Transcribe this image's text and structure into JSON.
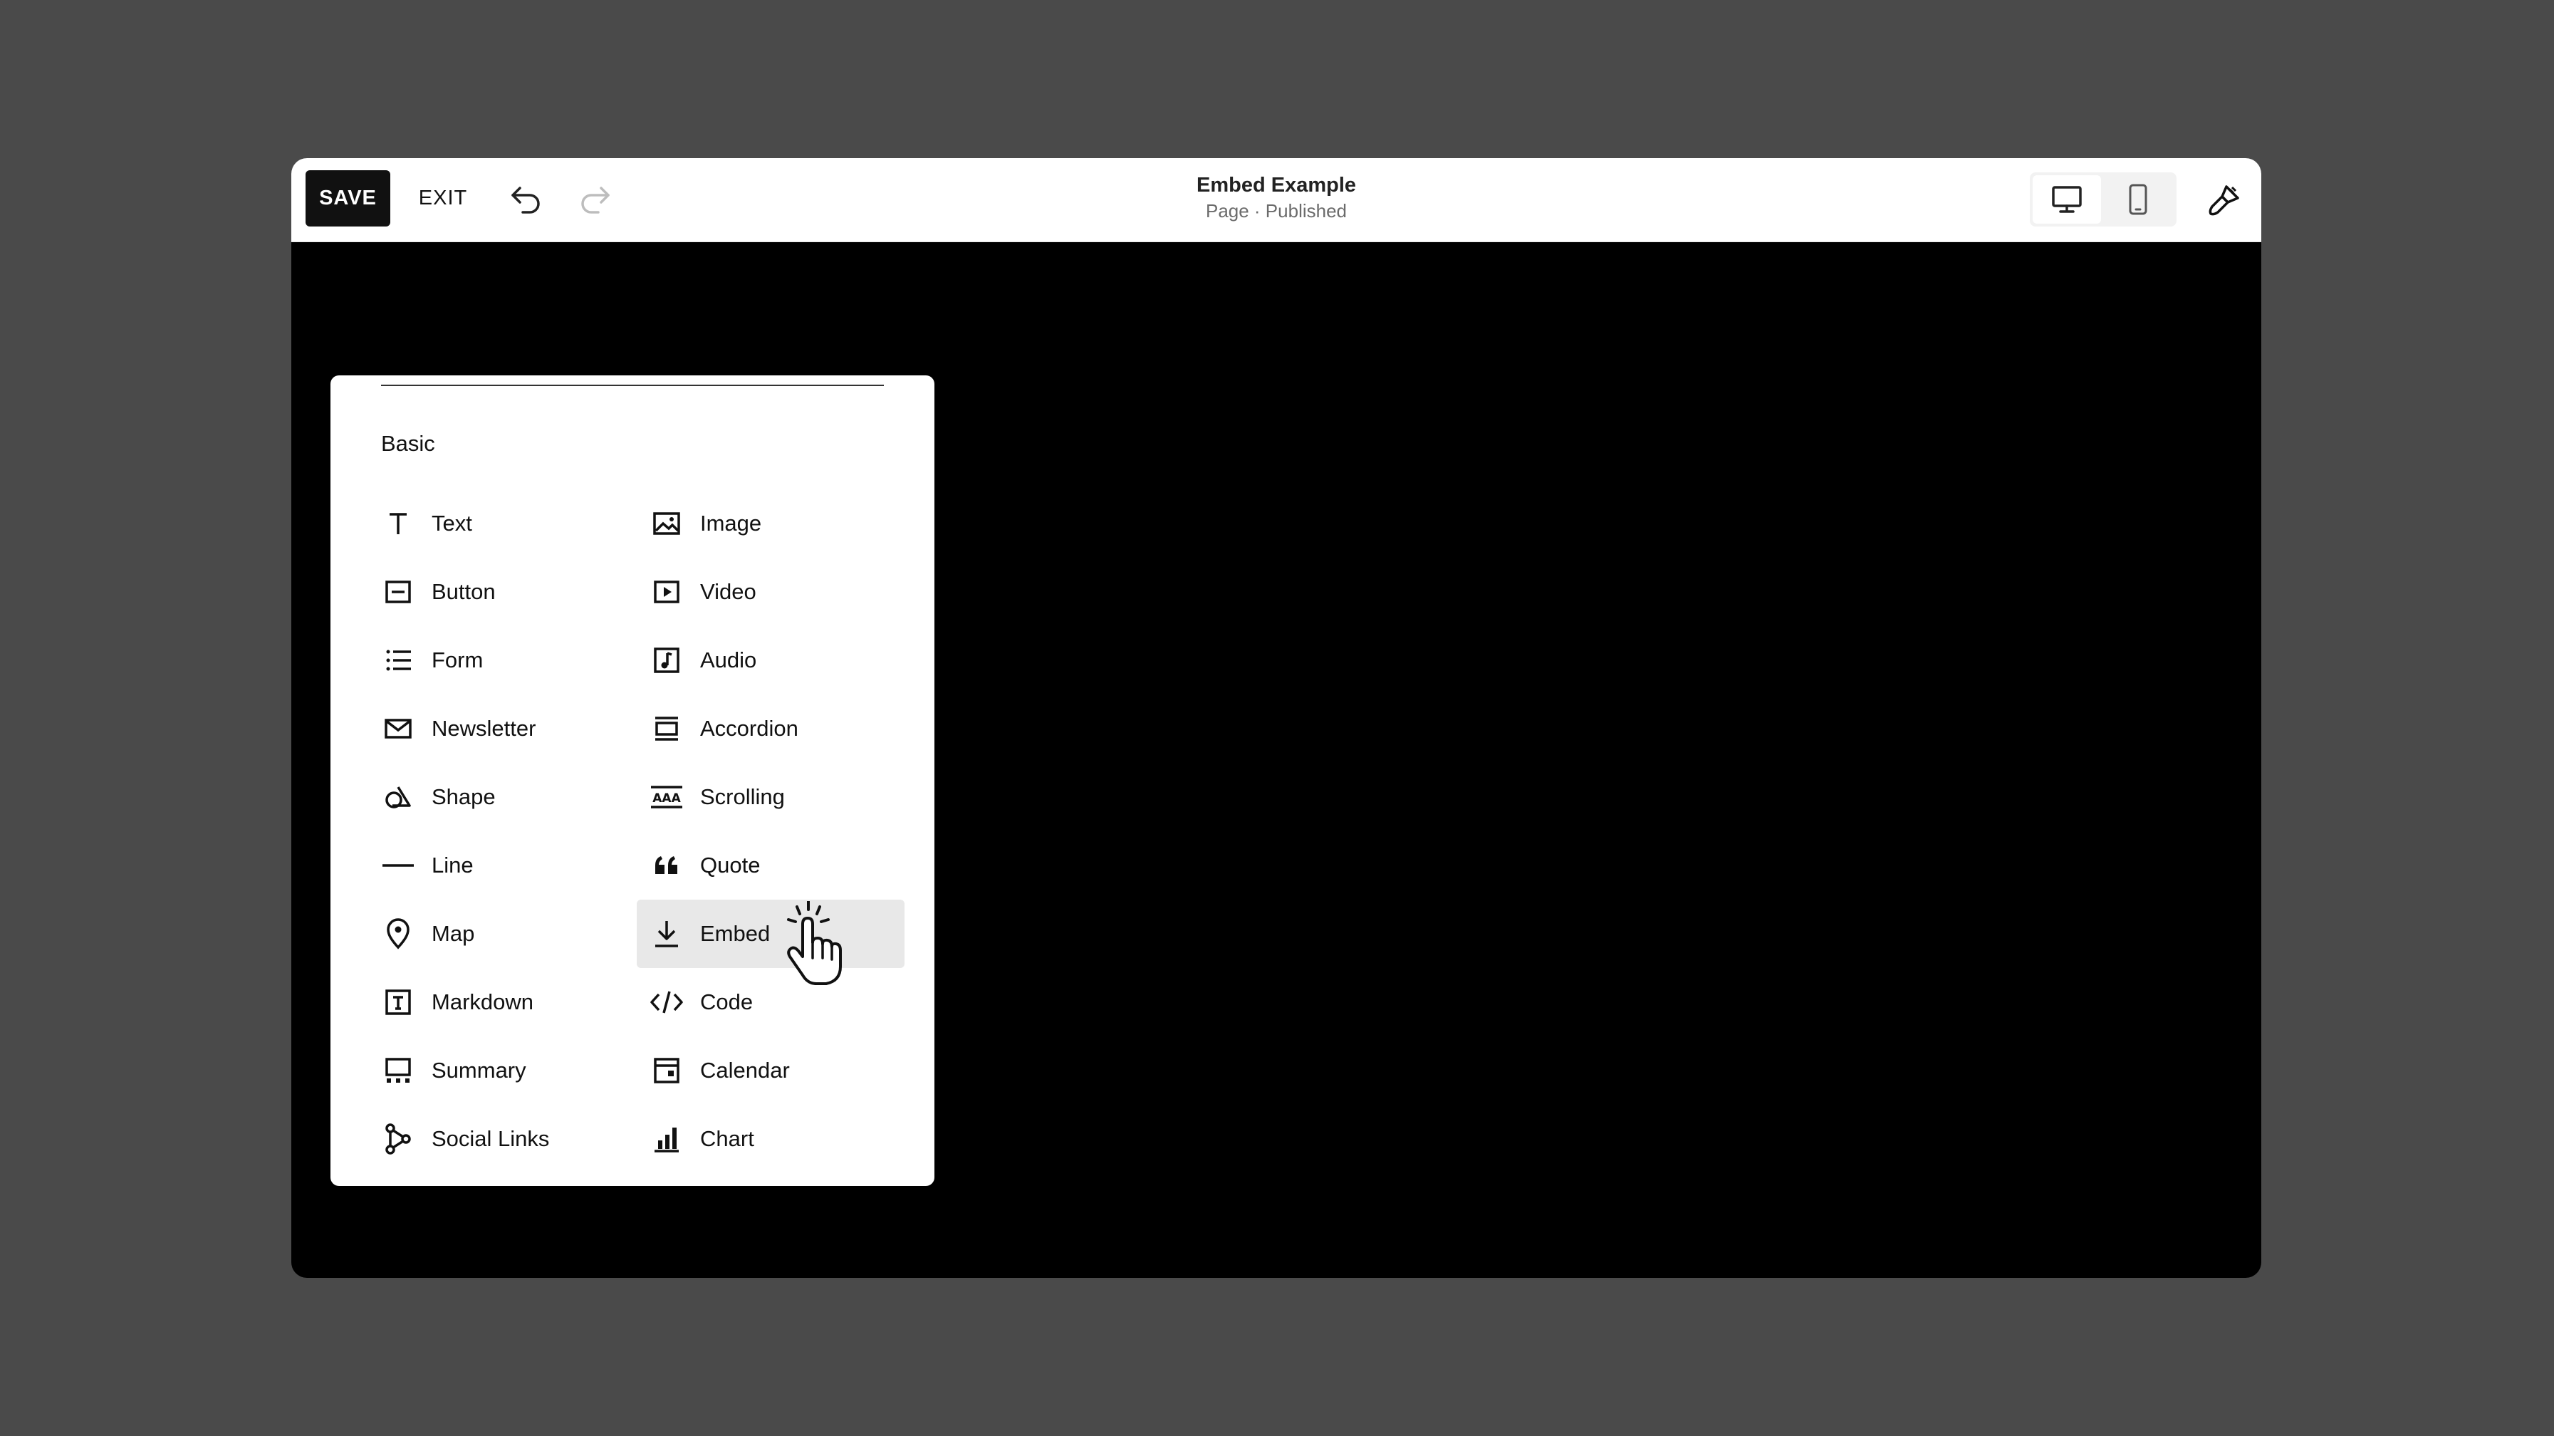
{
  "toolbar": {
    "save_label": "SAVE",
    "exit_label": "EXIT",
    "undo_icon": "undo-icon",
    "redo_icon": "redo-icon"
  },
  "header": {
    "title": "Embed Example",
    "status": "Page · Published"
  },
  "view_toggle": {
    "active": "desktop",
    "options": [
      "desktop",
      "mobile"
    ]
  },
  "block_panel": {
    "section": "Basic",
    "left_column": [
      {
        "label": "Text",
        "icon": "text-icon"
      },
      {
        "label": "Button",
        "icon": "button-icon"
      },
      {
        "label": "Form",
        "icon": "form-icon"
      },
      {
        "label": "Newsletter",
        "icon": "envelope-icon"
      },
      {
        "label": "Shape",
        "icon": "shape-icon"
      },
      {
        "label": "Line",
        "icon": "line-icon"
      },
      {
        "label": "Map",
        "icon": "map-pin-icon"
      },
      {
        "label": "Markdown",
        "icon": "markdown-icon"
      },
      {
        "label": "Summary",
        "icon": "summary-icon"
      },
      {
        "label": "Social Links",
        "icon": "social-links-icon"
      }
    ],
    "right_column": [
      {
        "label": "Image",
        "icon": "image-icon"
      },
      {
        "label": "Video",
        "icon": "video-icon"
      },
      {
        "label": "Audio",
        "icon": "audio-icon"
      },
      {
        "label": "Accordion",
        "icon": "accordion-icon"
      },
      {
        "label": "Scrolling",
        "icon": "scrolling-icon"
      },
      {
        "label": "Quote",
        "icon": "quote-icon"
      },
      {
        "label": "Embed",
        "icon": "embed-icon"
      },
      {
        "label": "Code",
        "icon": "code-icon"
      },
      {
        "label": "Calendar",
        "icon": "calendar-icon"
      },
      {
        "label": "Chart",
        "icon": "chart-icon"
      }
    ],
    "hovered": "Embed"
  },
  "colors": {
    "page_bg": "#4a4a4a",
    "canvas_bg": "#000000",
    "save_bg": "#111111",
    "hover_bg": "#e8e8e8"
  }
}
